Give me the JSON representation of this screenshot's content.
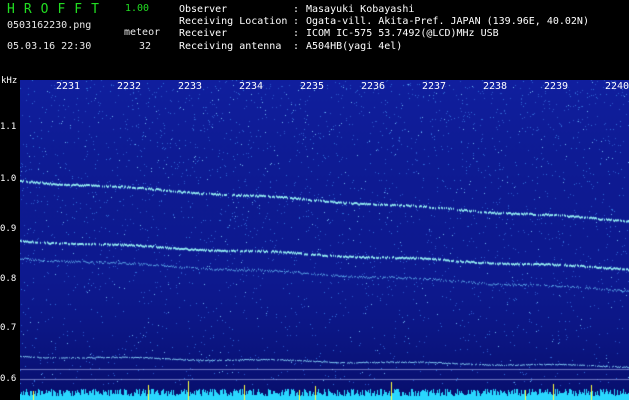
{
  "header": {
    "app_title": "HROFFT",
    "version": "1.00",
    "filename": "0503162230.png",
    "datetime": "05.03.16 22:30",
    "meteor_label": "meteor",
    "meteor_count": "32"
  },
  "info": [
    {
      "key": "Observer",
      "value": "Masayuki Kobayashi"
    },
    {
      "key": "Receiving Location",
      "value": "Ogata-vill. Akita-Pref. JAPAN (139.96E, 40.02N)"
    },
    {
      "key": "Receiver",
      "value": "ICOM IC-575 53.7492(@LCD)MHz USB"
    },
    {
      "key": "Receiving antenna",
      "value": "A504HB(yagi 4el)"
    }
  ],
  "spectrogram": {
    "y_unit": "kHz",
    "y_ticks": [
      "1.1",
      "1.0",
      "0.9",
      "0.8",
      "0.7",
      "0.6"
    ],
    "time_ticks": [
      "2231",
      "2232",
      "2233",
      "2234",
      "2235",
      "2236",
      "2237",
      "2238",
      "2239",
      "2240"
    ],
    "colors": {
      "background": "#0e1a92",
      "noise": "#2f6fd8",
      "signal": "#8fe8f0",
      "strong": "#ffff40",
      "baseline": "#29d7ff"
    }
  }
}
